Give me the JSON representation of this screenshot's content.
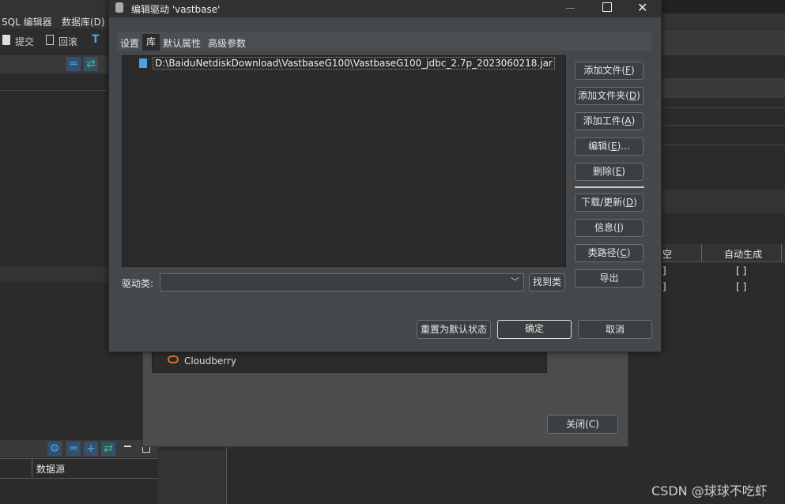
{
  "menubar": {
    "items": [
      "SQL 编辑器",
      "数据库(D)"
    ]
  },
  "toolbar": {
    "commit": "提交",
    "rollback": "回滚"
  },
  "bg_table": {
    "col_null": "空",
    "col_auto": "自动生成",
    "row1_a": "]",
    "row1_b": "[ ]",
    "row2_a": "]",
    "row2_b": "[ ]"
  },
  "bottom_panel": {
    "col_datasource": "数据源"
  },
  "driver_manager": {
    "list_item": "Cloudberry",
    "close_label": "关闭(C)",
    "close_key": "C"
  },
  "dialog": {
    "title": "编辑驱动 'vastbase'",
    "tabs": [
      "设置",
      "库",
      "默认属性",
      "高级参数"
    ],
    "library_entry": "D:\\BaiduNetdiskDownload\\VastbaseG100\\VastbaseG100_jdbc_2.7p_2023060218.jar",
    "buttons": {
      "add_file": "添加文件",
      "add_file_key": "F",
      "add_folder": "添加文件夹",
      "add_folder_key": "D",
      "add_artifact": "添加工件",
      "add_artifact_key": "A",
      "edit": "编辑",
      "edit_key": "E",
      "edit_suffix": "...",
      "delete": "删除",
      "delete_key": "E",
      "download": "下载/更新",
      "download_key": "D",
      "info": "信息",
      "info_key": "I",
      "classpath": "类路径",
      "classpath_key": "C",
      "export": "导出"
    },
    "driver_class_label": "驱动类:",
    "driver_class_value": "",
    "find_class": "找到类",
    "reset_default": "重置为默认状态",
    "ok": "确定",
    "cancel": "取消"
  },
  "watermark": "CSDN @球球不吃虾"
}
